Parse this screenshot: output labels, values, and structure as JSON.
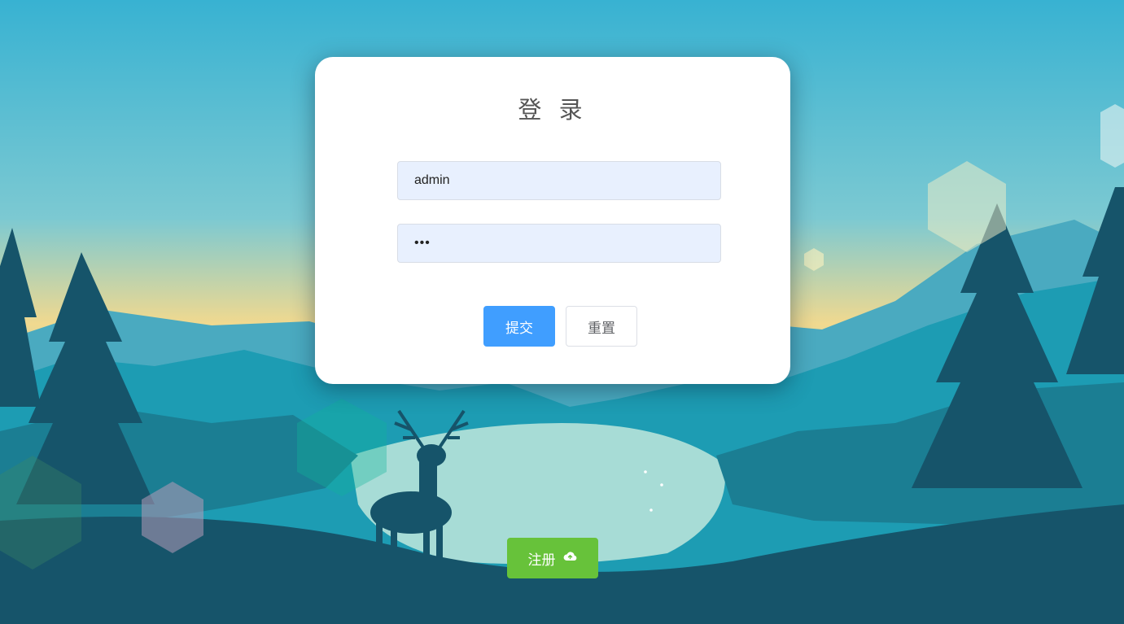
{
  "login": {
    "title": "登 录",
    "username_value": "admin",
    "password_value": "•••",
    "submit_label": "提交",
    "reset_label": "重置"
  },
  "register": {
    "label": "注册",
    "icon": "upload-cloud-icon"
  },
  "colors": {
    "primary": "#409eff",
    "success": "#67c23a",
    "input_bg": "#e8f0fe"
  }
}
